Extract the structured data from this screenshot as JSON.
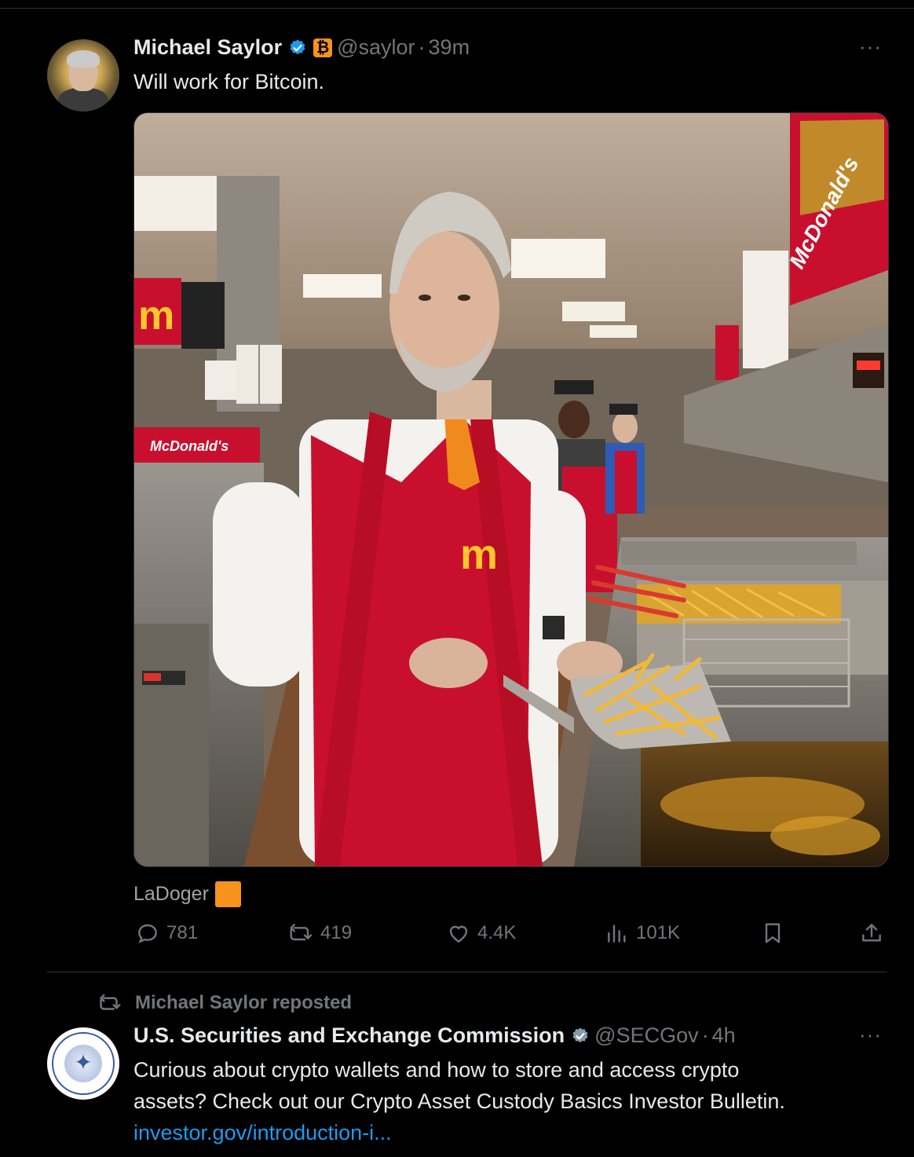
{
  "tweet1": {
    "author_name": "Michael Saylor",
    "handle": "@saylor",
    "separator": "·",
    "time": "39m",
    "text": "Will work for Bitcoin.",
    "image_signs": {
      "sign_large": "McDonald's",
      "sign_small": "McDonald's"
    },
    "caption": "LaDoger",
    "stats": {
      "replies": "781",
      "reposts": "419",
      "likes": "4.4K",
      "views": "101K"
    }
  },
  "repost_label": "Michael Saylor reposted",
  "tweet2": {
    "author_name": "U.S. Securities and Exchange Commission",
    "handle": "@SECGov",
    "separator": "·",
    "time": "4h",
    "text_line1": "Curious about crypto wallets and how to store and access crypto",
    "text_line2": "assets? Check out our Crypto Asset Custody Basics Investor Bulletin.",
    "link": "investor.gov/introduction-i..."
  },
  "more_label": "···",
  "colors": {
    "background": "#000000",
    "text": "#e7e9ea",
    "muted": "#71767b",
    "accent_blue": "#1d9bf0",
    "bitcoin_orange": "#f7931a",
    "mcdonalds_red": "#c8102e",
    "mcdonalds_gold": "#ffc72c"
  }
}
